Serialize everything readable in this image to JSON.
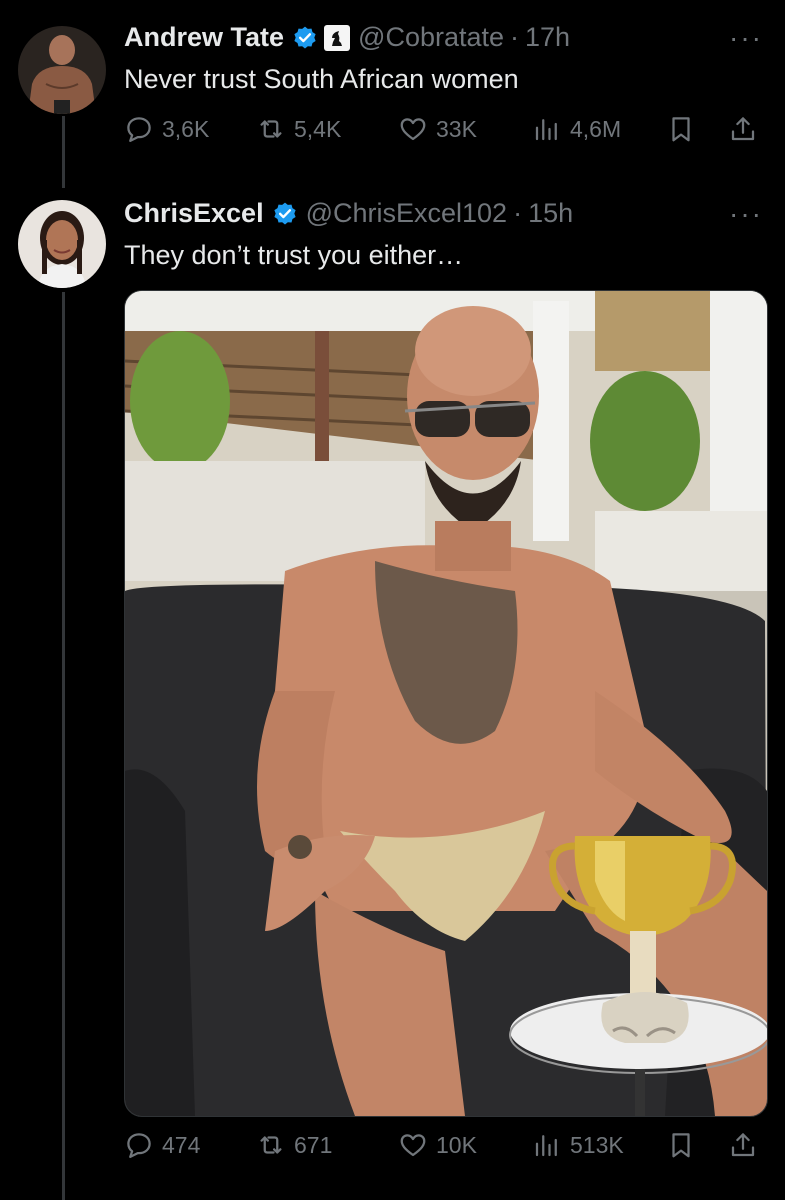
{
  "tweet1": {
    "name": "Andrew Tate",
    "handle": "@Cobratate",
    "dot": "·",
    "time": "17h",
    "text": "Never trust South African women",
    "replies": "3,6K",
    "retweets": "5,4K",
    "likes": "33K",
    "views": "4,6M",
    "more": "···"
  },
  "tweet2": {
    "name": "ChrisExcel",
    "handle": "@ChrisExcel102",
    "dot": "·",
    "time": "15h",
    "text": "They don’t trust you either…",
    "replies": "474",
    "retweets": "671",
    "likes": "10K",
    "views": "513K",
    "more": "···"
  },
  "colors": {
    "verified": "#1d9bf0",
    "muted": "#71767b",
    "text": "#e7e9ea",
    "background": "#000000"
  }
}
